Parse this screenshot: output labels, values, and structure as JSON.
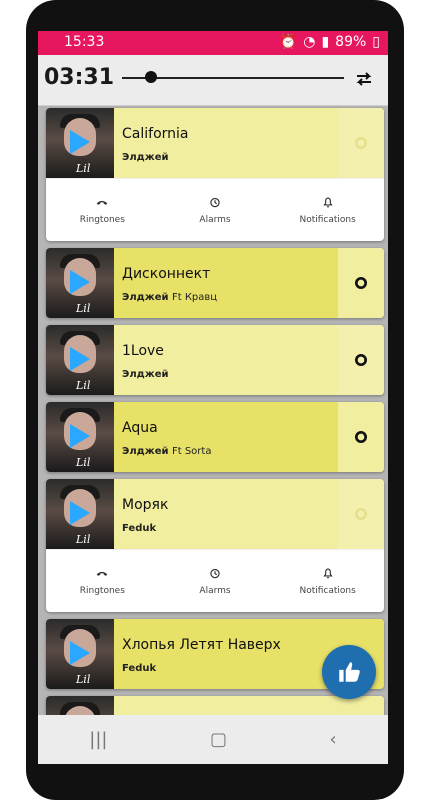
{
  "status_bar": {
    "time": "15:33",
    "battery": "89%"
  },
  "player": {
    "elapsed": "03:31",
    "progress": 0.1
  },
  "songs": [
    {
      "title": "California",
      "artist": "Элджей",
      "featuring": "",
      "expanded": true,
      "bg": "#f1ee9f",
      "gear_bg": "#f3f0ad"
    },
    {
      "title": "Дисконнект",
      "artist": "Элджей",
      "featuring": "Ft Кравц",
      "expanded": false,
      "bg": "#e7e167",
      "gear_bg": "#f1ee9f"
    },
    {
      "title": "1Love",
      "artist": "Элджей",
      "featuring": "",
      "expanded": false,
      "bg": "#f1ee9f",
      "gear_bg": "#f3f0ad"
    },
    {
      "title": "Aqua",
      "artist": "Элджей",
      "featuring": "Ft Sorta",
      "expanded": false,
      "bg": "#e7e167",
      "gear_bg": "#f1ee9f"
    },
    {
      "title": "Моряк",
      "artist": "Feduk",
      "featuring": "",
      "expanded": true,
      "bg": "#f1ee9f",
      "gear_bg": "#f3f0ad"
    },
    {
      "title": "Хлопья Летят Наверх",
      "artist": "Feduk",
      "featuring": "",
      "expanded": false,
      "bg": "#e7e167",
      "gear_bg": "#f1ee9f"
    }
  ],
  "actions": {
    "ringtones": "Ringtones",
    "alarms": "Alarms",
    "notifications": "Notifications"
  },
  "colors": {
    "status_bar": "#e6175e",
    "fab": "#1f6fb0"
  }
}
